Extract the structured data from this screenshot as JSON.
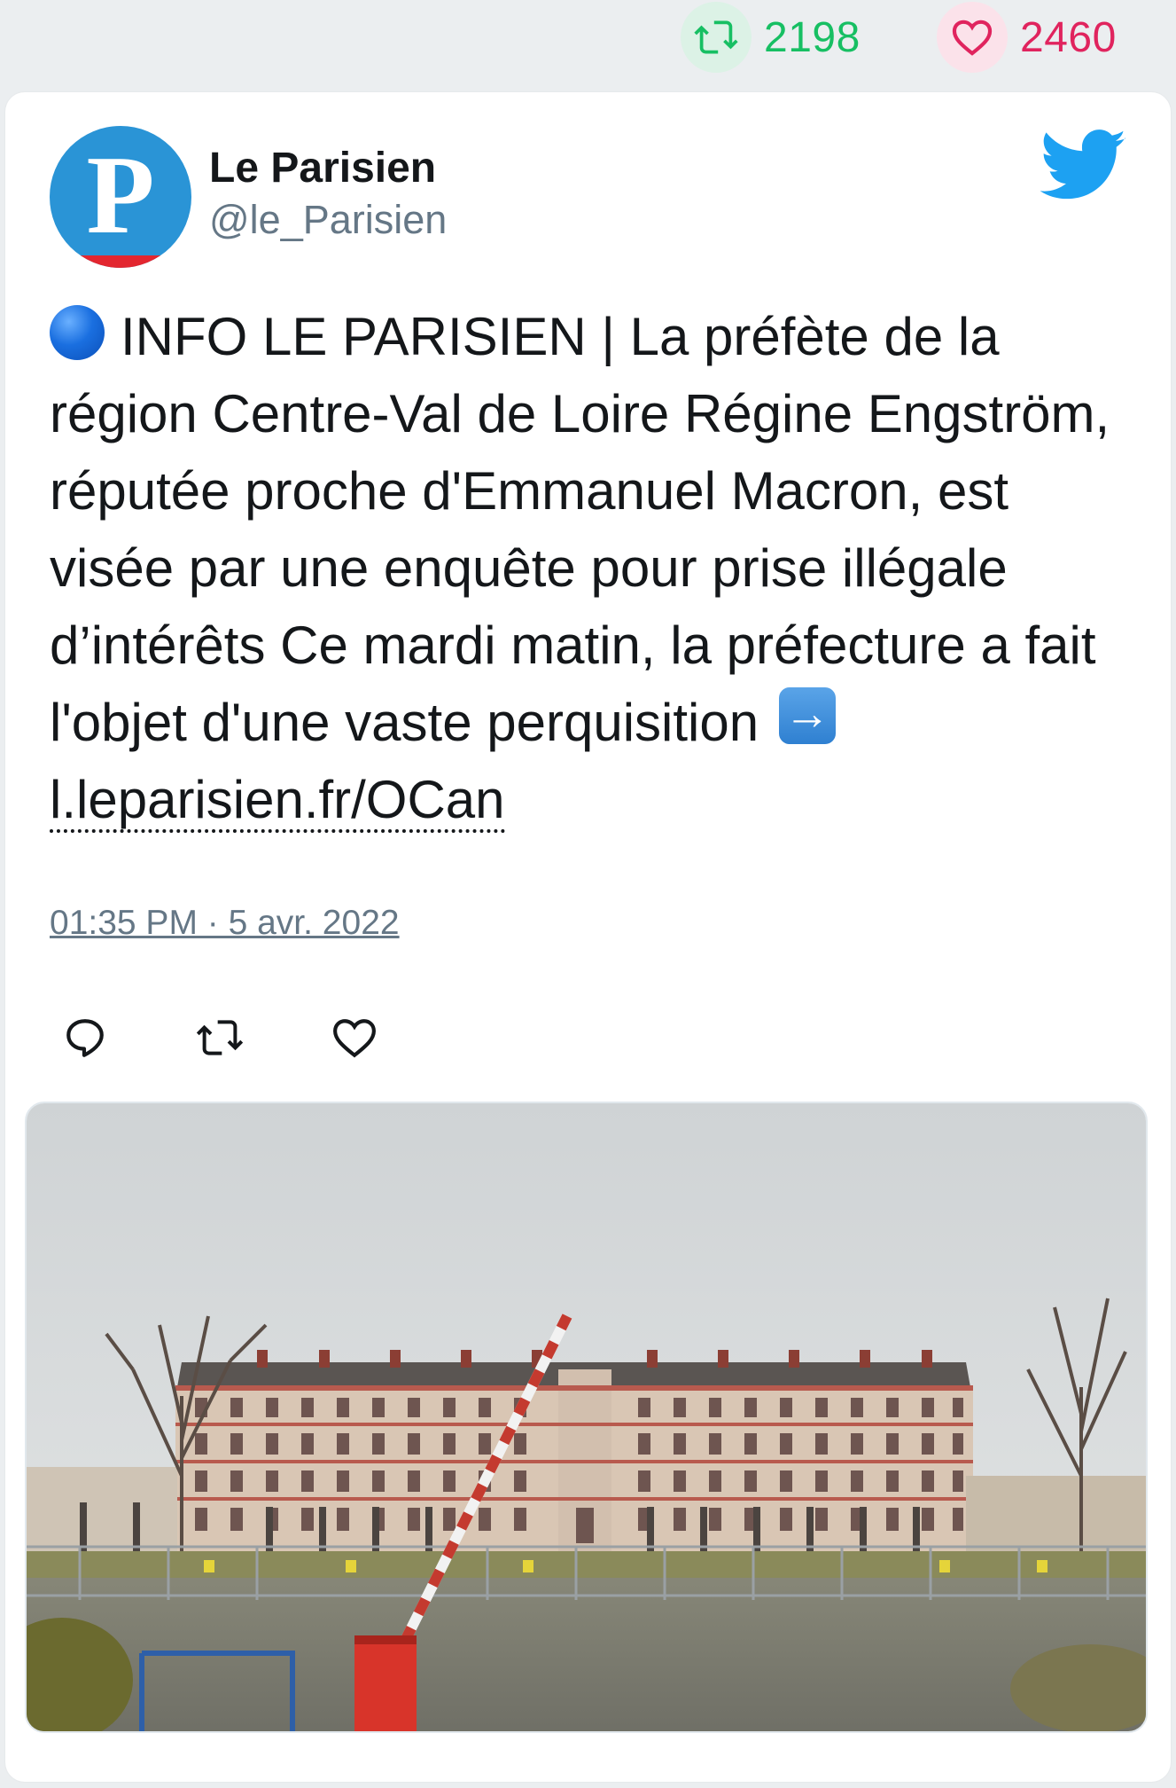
{
  "stats": {
    "retweets": "2198",
    "likes": "2460",
    "retweet_color": "#17bf63",
    "like_color": "#e0245e"
  },
  "author": {
    "name": "Le Parisien",
    "handle": "@le_Parisien",
    "avatar_letter": "P",
    "avatar_color": "#2a94d6"
  },
  "tweet": {
    "text_main": "INFO LE PARISIEN | La préfète de la région Centre-Val de Loire Régine Engström, réputée proche d'Emmanuel Macron, est visée par une enquête pour prise illégale d’intérêts Ce mardi matin, la préfecture a fait l'objet d'une vaste perquisition",
    "link": "l.leparisien.fr/OCan",
    "timestamp": "01:35 PM · 5 avr. 2022",
    "emoji_lead": "blue-circle-emoji",
    "emoji_arrow": "right-arrow-emoji"
  },
  "icons": {
    "brand": "twitter-bird-icon",
    "reply": "reply-icon",
    "retweet": "retweet-icon",
    "like": "heart-icon",
    "brand_color": "#1da1f2"
  }
}
